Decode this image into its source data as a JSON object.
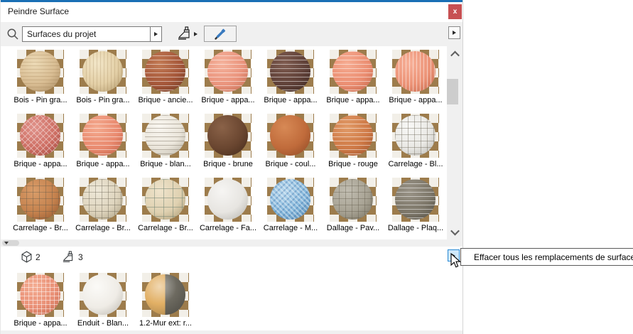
{
  "window": {
    "title": "Peindre Surface",
    "close_label": "x"
  },
  "colors": {
    "accent_blue": "#1a6fb5",
    "close_red": "#c75053",
    "toolbar_bg": "#f0f0f0",
    "hover_border": "#2a8ad4",
    "hover_bg": "#cfe8fa",
    "check_brown": "#9d7c4c",
    "check_light": "#f2efe8",
    "scroll_track": "#f0f0f0",
    "scroll_thumb": "#cdcdcd",
    "tooltip_border": "#5a5a5a",
    "eyedropper_blue": "#3a7bbf"
  },
  "toolbar": {
    "search_value": "Surfaces du projet",
    "search_icon": "magnifier",
    "brush_icon": "paintbrush",
    "eyedropper_icon": "eyedropper",
    "dropdown_glyph": "▶"
  },
  "materials": [
    {
      "label": "Bois - Pin gra...",
      "pattern": "wood-h",
      "base": "#d8bc92",
      "hl": "#ecdab6",
      "dk": "#a5875e"
    },
    {
      "label": "Bois - Pin gra...",
      "pattern": "wood-v",
      "base": "#e3cfa6",
      "hl": "#f2e6c8",
      "dk": "#b29a6e"
    },
    {
      "label": "Brique - ancie...",
      "pattern": "brick",
      "base": "#a5573a",
      "hl": "#c27a54",
      "dk": "#6d3a24"
    },
    {
      "label": "Brique - appa...",
      "pattern": "brick",
      "base": "#ea947d",
      "hl": "#f5b29c",
      "dk": "#c16c52"
    },
    {
      "label": "Brique - appa...",
      "pattern": "brick",
      "base": "#604139",
      "hl": "#7f5c50",
      "dk": "#3d2822"
    },
    {
      "label": "Brique - appa...",
      "pattern": "brick",
      "base": "#eb8e72",
      "hl": "#f6ac92",
      "dk": "#c3664a"
    },
    {
      "label": "Brique - appa...",
      "pattern": "v",
      "base": "#ec9377",
      "hl": "#f7b098",
      "dk": "#c56a4e"
    },
    {
      "label": "Brique - appa...",
      "pattern": "hb",
      "base": "#ce6f64",
      "hl": "#e0928a",
      "dk": "#a24840"
    },
    {
      "label": "Brique - appa...",
      "pattern": "brick",
      "base": "#e98a6f",
      "hl": "#f4a98e",
      "dk": "#c06046"
    },
    {
      "label": "Brique - blan...",
      "pattern": "brick-d",
      "base": "#ebe6db",
      "hl": "#f9f6f0",
      "dk": "#b7b0a2"
    },
    {
      "label": "Brique - brune",
      "pattern": "plain",
      "base": "#6a4630",
      "hl": "#8a6248",
      "dk": "#452b1b"
    },
    {
      "label": "Brique - coul...",
      "pattern": "plain",
      "base": "#c06b3b",
      "hl": "#d78955",
      "dk": "#8e4925"
    },
    {
      "label": "Brique - rouge",
      "pattern": "brick",
      "base": "#cf7a47",
      "hl": "#e19a67",
      "dk": "#9e522b"
    },
    {
      "label": "Carrelage - Bl...",
      "pattern": "grid-d",
      "base": "#e9e8e4",
      "hl": "#f8f8f6",
      "dk": "#b7b5af"
    },
    {
      "label": "Carrelage - Br...",
      "pattern": "grid-d",
      "base": "#c5824e",
      "hl": "#d99d6a",
      "dk": "#92562d"
    },
    {
      "label": "Carrelage - Br...",
      "pattern": "grid-d",
      "base": "#ded4bd",
      "hl": "#eee8d8",
      "dk": "#a99d80"
    },
    {
      "label": "Carrelage - Br...",
      "pattern": "grid-g",
      "base": "#dfd1b1",
      "hl": "#eee3cb",
      "dk": "#aa9a74"
    },
    {
      "label": "Carrelage - Fa...",
      "pattern": "plain",
      "base": "#e7e5e1",
      "hl": "#f6f5f3",
      "dk": "#b5b3ad"
    },
    {
      "label": "Carrelage - M...",
      "pattern": "mosaic",
      "base": "#84b7db",
      "hl": "#b7d7ed",
      "dk": "#5184ae"
    },
    {
      "label": "Dallage - Pav...",
      "pattern": "grid-d",
      "base": "#a7a293",
      "hl": "#c1bdb1",
      "dk": "#767060"
    },
    {
      "label": "Dallage - Plaq...",
      "pattern": "brick",
      "base": "#7d7769",
      "hl": "#999387",
      "dk": "#544f45"
    }
  ],
  "bottom": {
    "model_count": "2",
    "painted_count": "3",
    "model_icon": "cube",
    "painted_icon": "paintbrush",
    "tooltip": "Effacer tous les remplacements de surface",
    "materials": [
      {
        "label": "Brique - appa...",
        "pattern": "grid",
        "base": "#e98f75",
        "hl": "#f4ad93",
        "dk": "#c1654b"
      },
      {
        "label": "Enduit - Blan...",
        "pattern": "plain",
        "base": "#efece6",
        "hl": "#fbfaf7",
        "dk": "#bcb8af"
      },
      {
        "label": "1.2-Mur ext: r...",
        "pattern": "split",
        "base": "#e2b065",
        "hl": "#f0cf96",
        "dk": "#6d6a60"
      }
    ]
  }
}
